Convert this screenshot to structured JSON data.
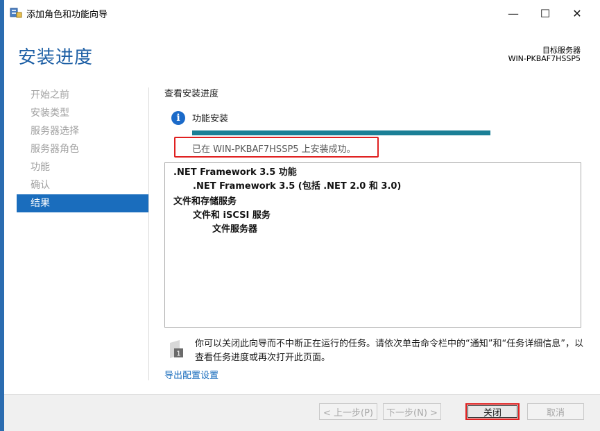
{
  "window": {
    "title": "添加角色和功能向导",
    "minimize_glyph": "—",
    "maximize_glyph": "☐",
    "close_glyph": "✕"
  },
  "header": {
    "page_title": "安装进度",
    "target_label": "目标服务器",
    "target_name": "WIN-PKBAF7HSSP5"
  },
  "nav": {
    "items": [
      {
        "label": "开始之前",
        "active": false
      },
      {
        "label": "安装类型",
        "active": false
      },
      {
        "label": "服务器选择",
        "active": false
      },
      {
        "label": "服务器角色",
        "active": false
      },
      {
        "label": "功能",
        "active": false
      },
      {
        "label": "确认",
        "active": false
      },
      {
        "label": "结果",
        "active": true
      }
    ]
  },
  "content": {
    "section_heading": "查看安装进度",
    "feature_label": "功能安装",
    "progress": 1.0,
    "status_text": "已在 WIN-PKBAF7HSSP5 上安装成功。",
    "results": [
      ".NET Framework 3.5 功能",
      ".NET Framework 3.5 (包括 .NET 2.0 和 3.0)",
      "文件和存储服务",
      "文件和 iSCSI 服务",
      "文件服务器"
    ],
    "note_line1": "你可以关闭此向导而不中断正在运行的任务。请依次单击命令栏中的“通知”和“任务详细信息”，以",
    "note_line2": "查看任务进度或再次打开此页面。",
    "export_link": "导出配置设置"
  },
  "footer": {
    "prev_label": "< 上一步(P)",
    "next_label": "下一步(N) >",
    "close_label": "关闭",
    "cancel_label": "取消"
  },
  "colors": {
    "accent": "#1a6dbd",
    "progress": "#1b7f96",
    "highlight": "#e02020"
  }
}
